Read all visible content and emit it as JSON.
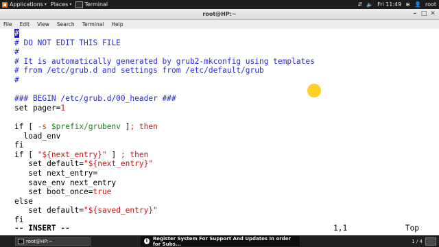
{
  "topbar": {
    "applications": "Applications",
    "places": "Places",
    "active_app": "Terminal",
    "clock": "Fri 11:49",
    "user": "root"
  },
  "window": {
    "title": "root@HP:~"
  },
  "menu": [
    "File",
    "Edit",
    "View",
    "Search",
    "Terminal",
    "Help"
  ],
  "editor": {
    "lines": [
      "#",
      "# DO NOT EDIT THIS FILE",
      "#",
      "# It is automatically generated by grub2-mkconfig using templates",
      "# from /etc/grub.d and settings from /etc/default/grub",
      "#",
      "",
      "### BEGIN /etc/grub.d/00_header ###",
      "set pager=1",
      "",
      "if [ -s $prefix/grubenv ]; then",
      "  load_env",
      "fi",
      "if [ \"${next_entry}\" ] ; then",
      "   set default=\"${next_entry}\"",
      "   set next_entry=",
      "   save_env next_entry",
      "   set boot_once=true",
      "else",
      "   set default=\"${saved_entry}\"",
      "fi"
    ],
    "mode": "-- INSERT --",
    "cursor_position": "1,1",
    "scroll_position": "Top"
  },
  "taskbar": {
    "task_label": "root@HP:~",
    "notification": "Register System For Support And Updates  In order for Subs...",
    "workspace": "1 / 4"
  }
}
